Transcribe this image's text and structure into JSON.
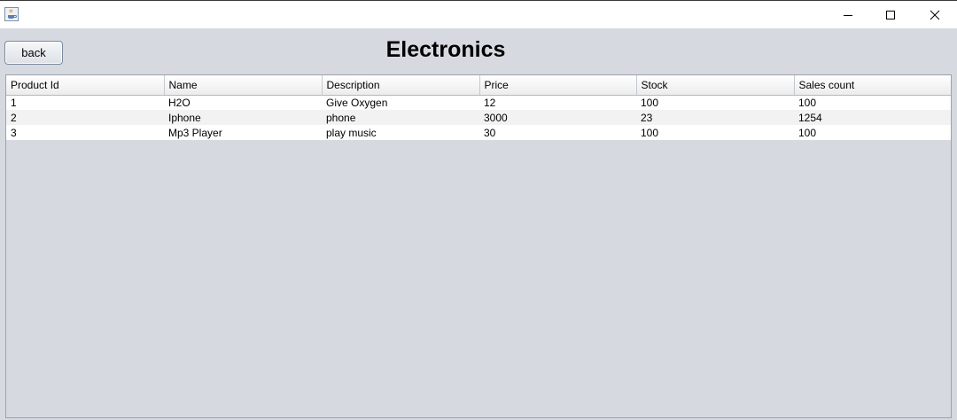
{
  "window": {
    "app_icon": "java-coffee-cup-icon",
    "controls": [
      "minimize-icon",
      "maximize-icon",
      "close-icon"
    ]
  },
  "toolbar": {
    "back_label": "back"
  },
  "page": {
    "title": "Electronics"
  },
  "table": {
    "columns": [
      "Product Id",
      "Name",
      "Description",
      "Price",
      "Stock",
      "Sales count"
    ],
    "rows": [
      [
        "1",
        "H2O",
        "Give Oxygen",
        "12",
        "100",
        "100"
      ],
      [
        "2",
        "Iphone",
        "phone",
        "3000",
        "23",
        "1254"
      ],
      [
        "3",
        "Mp3 Player",
        "play music",
        "30",
        "100",
        "100"
      ]
    ]
  }
}
